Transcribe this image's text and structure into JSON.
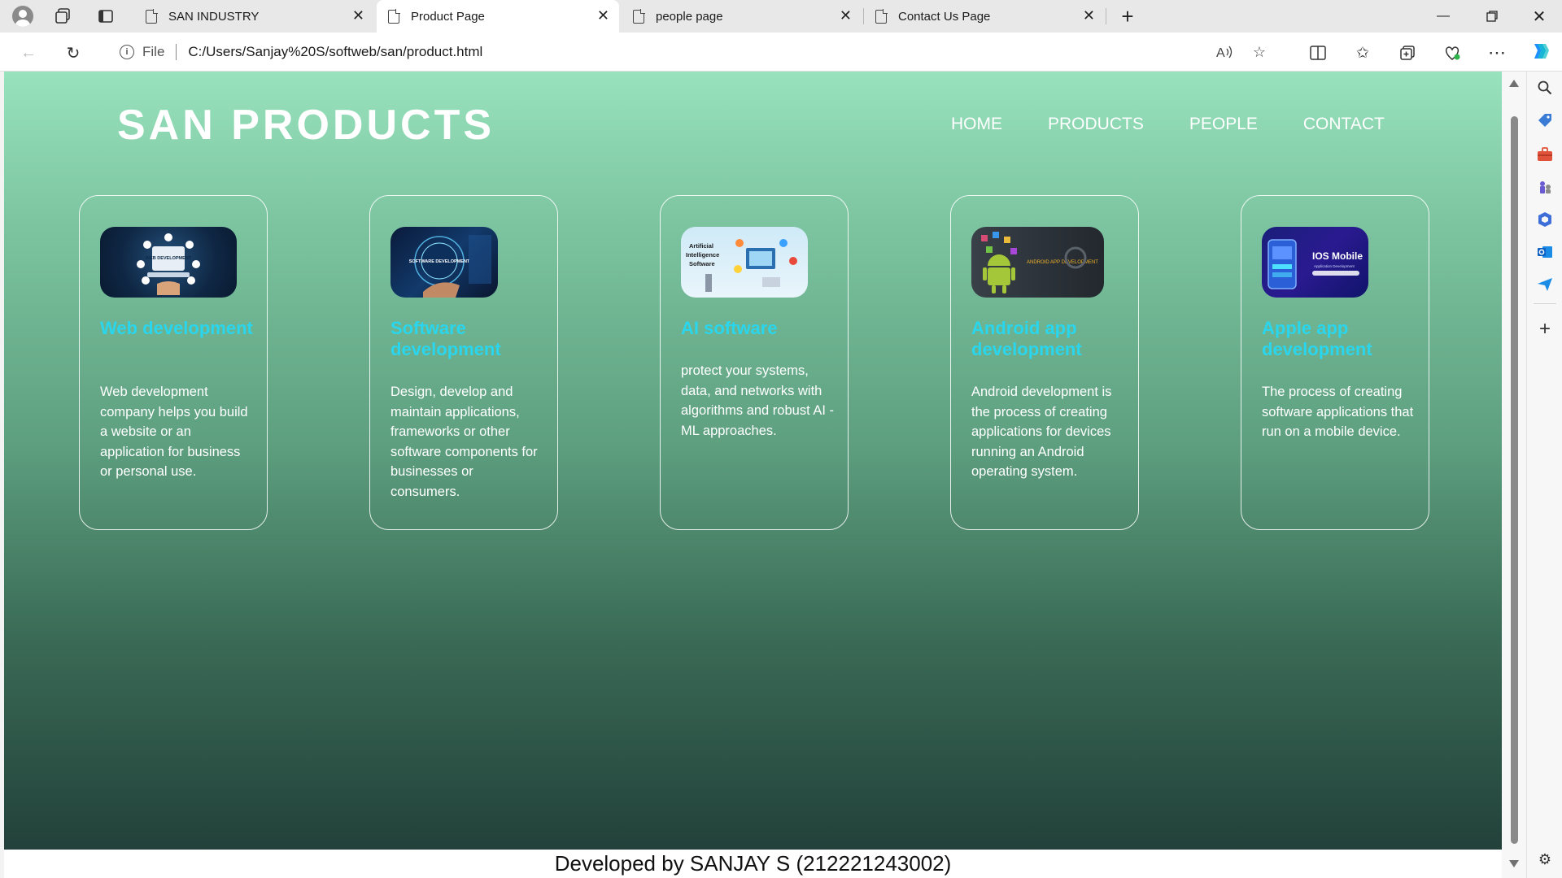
{
  "browser": {
    "tabs": [
      {
        "title": "SAN INDUSTRY",
        "active": false
      },
      {
        "title": "Product Page",
        "active": true
      },
      {
        "title": "people page",
        "active": false
      },
      {
        "title": "Contact Us Page",
        "active": false
      }
    ],
    "address": {
      "scheme_label": "File",
      "url": "C:/Users/Sanjay%20S/softweb/san/product.html"
    }
  },
  "page": {
    "brand": "SAN PRODUCTS",
    "nav": [
      "HOME",
      "PRODUCTS",
      "PEOPLE",
      "CONTACT"
    ],
    "cards": [
      {
        "title": "Web development",
        "text": "Web development company helps you build a website or an application for business or personal use.",
        "thumb_text": "WEB DEVELOPMENT"
      },
      {
        "title": "Software development",
        "text": "Design, develop and maintain applications, frameworks or other software components for businesses or consumers.",
        "thumb_text": "SOFTWARE DEVELOPMENT"
      },
      {
        "title": "AI software",
        "text": "protect your systems, data, and networks with algorithms and robust AI - ML approaches.",
        "thumb_text": "Artificial Intelligence Software"
      },
      {
        "title": "Android app development",
        "text": "Android development is the process of creating applications for devices running an Android operating system.",
        "thumb_text": "ANDROID APP DEVELOPMENT"
      },
      {
        "title": "Apple app development",
        "text": "The process of creating software applications that run on a mobile device.",
        "thumb_text": "IOS Mobile",
        "thumb_subtext": "Application Development"
      }
    ],
    "footer": "Developed by SANJAY S (212221243002)"
  },
  "colors": {
    "card_title": "#29d6ee",
    "gradient_top": "#98e2bd",
    "gradient_bottom": "#22413a"
  }
}
